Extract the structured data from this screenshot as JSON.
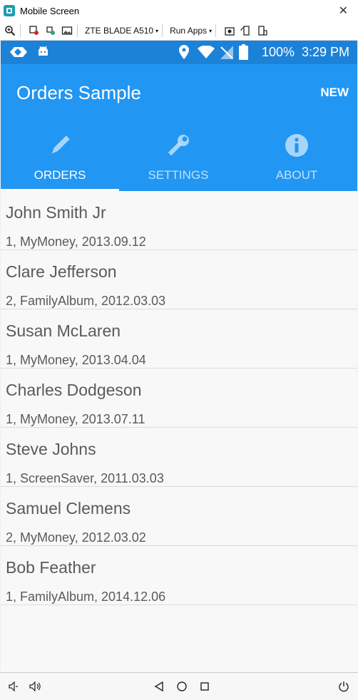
{
  "window": {
    "title": "Mobile Screen",
    "close_glyph": "✕"
  },
  "toolbar": {
    "device_label": "ZTE BLADE A510",
    "run_apps_label": "Run Apps",
    "dropdown_arrow": "▾",
    "icons": [
      "zoom-icon",
      "inspect-icon",
      "record-icon",
      "image-icon",
      "screenshot-icon",
      "rotate-icon",
      "resize-icon"
    ]
  },
  "statusbar": {
    "battery_pct": "100%",
    "time": "3:29 PM"
  },
  "app": {
    "title": "Orders Sample",
    "new_label": "NEW",
    "tabs": [
      {
        "label": "ORDERS",
        "icon": "pencil-icon",
        "active": true
      },
      {
        "label": "SETTINGS",
        "icon": "wrench-icon",
        "active": false
      },
      {
        "label": "ABOUT",
        "icon": "info-icon",
        "active": false
      }
    ],
    "colors": {
      "primary": "#2196f3",
      "status": "#1c82d8",
      "text": "#5a5a5a"
    }
  },
  "orders": [
    {
      "name": "John Smith Jr",
      "detail": "1, MyMoney, 2013.09.12"
    },
    {
      "name": "Clare Jefferson",
      "detail": "2, FamilyAlbum, 2012.03.03"
    },
    {
      "name": "Susan McLaren",
      "detail": "1, MyMoney, 2013.04.04"
    },
    {
      "name": "Charles Dodgeson",
      "detail": "1, MyMoney, 2013.07.11"
    },
    {
      "name": "Steve Johns",
      "detail": "1, ScreenSaver, 2011.03.03"
    },
    {
      "name": "Samuel Clemens",
      "detail": "2, MyMoney, 2012.03.02"
    },
    {
      "name": "Bob Feather",
      "detail": "1, FamilyAlbum, 2014.12.06"
    }
  ]
}
